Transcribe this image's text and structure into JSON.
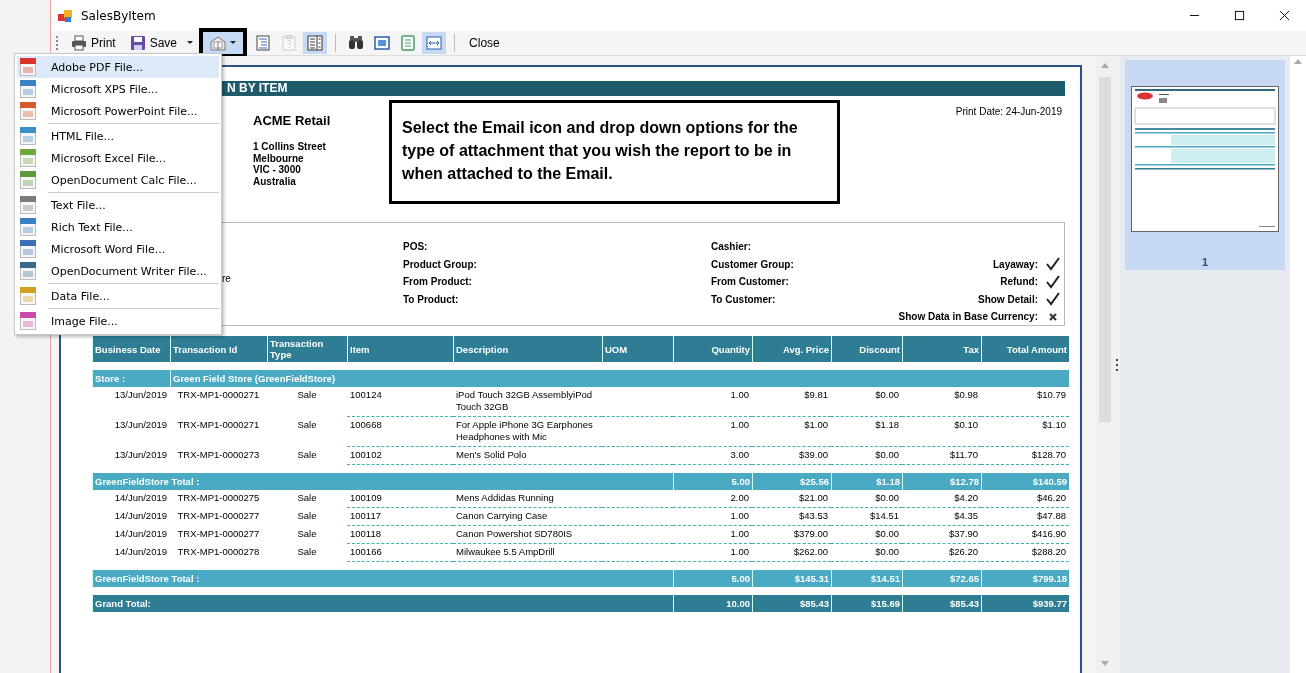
{
  "window": {
    "title": "SalesByItem"
  },
  "toolbar": {
    "items": [
      {
        "kind": "print",
        "label": "Print",
        "pressed": false,
        "disabled": false,
        "outlined": false
      },
      {
        "kind": "save",
        "label": "Save",
        "pressed": false,
        "disabled": false,
        "outlined": false
      },
      {
        "kind": "email",
        "pressed": true,
        "disabled": false,
        "outlined": true
      },
      {
        "kind": "document-map",
        "pressed": false,
        "disabled": false,
        "outlined": false
      },
      {
        "kind": "parameters",
        "pressed": false,
        "disabled": true,
        "outlined": false
      },
      {
        "kind": "thumbnails",
        "pressed": true,
        "disabled": false,
        "outlined": false
      },
      {
        "kind": "separator"
      },
      {
        "kind": "find",
        "pressed": false,
        "disabled": false,
        "outlined": false
      },
      {
        "kind": "single-page",
        "pressed": false,
        "disabled": false,
        "outlined": false
      },
      {
        "kind": "whole-page",
        "pressed": false,
        "disabled": false,
        "outlined": false
      },
      {
        "kind": "page-width",
        "pressed": true,
        "disabled": false,
        "outlined": false
      },
      {
        "kind": "separator"
      },
      {
        "kind": "close",
        "label": "Close",
        "pressed": false,
        "disabled": false,
        "outlined": false
      }
    ]
  },
  "export_menu": {
    "groups": [
      [
        {
          "label": "Adobe PDF File...",
          "color": "#d9342b",
          "selected": true
        },
        {
          "label": "Microsoft XPS File...",
          "color": "#3b7fc4",
          "selected": false
        },
        {
          "label": "Microsoft PowerPoint File...",
          "color": "#d65a2a",
          "selected": false
        }
      ],
      [
        {
          "label": "HTML File...",
          "color": "#3b8fc4",
          "selected": false
        },
        {
          "label": "Microsoft Excel File...",
          "color": "#6fa83a",
          "selected": false
        },
        {
          "label": "OpenDocument Calc File...",
          "color": "#5a9a3a",
          "selected": false
        }
      ],
      [
        {
          "label": "Text File...",
          "color": "#7a7a7a",
          "selected": false
        },
        {
          "label": "Rich Text File...",
          "color": "#3b7fc4",
          "selected": false
        },
        {
          "label": "Microsoft Word File...",
          "color": "#3b6fb4",
          "selected": false
        },
        {
          "label": "OpenDocument Writer File...",
          "color": "#3a6a8a",
          "selected": false
        }
      ],
      [
        {
          "label": "Data File...",
          "color": "#d4a020",
          "selected": false
        }
      ],
      [
        {
          "label": "Image File...",
          "color": "#c84aa8",
          "selected": false
        }
      ]
    ]
  },
  "report": {
    "title": "N BY ITEM",
    "company": {
      "name": "ACME Retail",
      "address": [
        "1 Collins Street",
        "Melbourne",
        "VIC - 3000",
        "Australia"
      ]
    },
    "print_date": "Print Date: 24-Jun-2019",
    "callout": "Select the Email icon and drop down options for the type of attachment that you wish the report to be in when attached to the Email.",
    "filters": {
      "left_fragment": "re",
      "middle": [
        "POS:",
        "Product Group:",
        "From Product:",
        "To Product:"
      ],
      "right": [
        "Cashier:",
        "Customer Group:",
        "From Customer:",
        "To Customer:"
      ],
      "options": [
        {
          "label": "Layaway:",
          "checked": true
        },
        {
          "label": "Refund:",
          "checked": true
        },
        {
          "label": "Show Detail:",
          "checked": true
        },
        {
          "label": "Show Data in Base Currency:",
          "checked": false
        }
      ]
    },
    "table": {
      "columns": [
        "Business Date",
        "Transaction Id",
        "Transaction Type",
        "Item",
        "Description",
        "UOM",
        "Quantity",
        "Avg. Price",
        "Discount",
        "Tax",
        "Total Amount"
      ],
      "rows": [
        {
          "kind": "store",
          "label": "Store :",
          "value": "Green Field Store (GreenFieldStore)"
        },
        {
          "kind": "data",
          "cells": [
            "13/Jun/2019",
            "TRX-MP1-0000271",
            "Sale",
            "100124",
            "iPod Touch 32GB AssemblyiPod Touch 32GB",
            "",
            "1.00",
            "$9.81",
            "$0.00",
            "$0.98",
            "$10.79"
          ]
        },
        {
          "kind": "data",
          "cells": [
            "13/Jun/2019",
            "TRX-MP1-0000271",
            "Sale",
            "100668",
            "For Apple iPhone 3G Earphones Headphones with Mic",
            "",
            "1.00",
            "$1.00",
            "$1.18",
            "$0.10",
            "$1.10"
          ]
        },
        {
          "kind": "data",
          "cells": [
            "13/Jun/2019",
            "TRX-MP1-0000273",
            "Sale",
            "100102",
            "Men's Solid Polo",
            "",
            "3.00",
            "$39.00",
            "$0.00",
            "$11.70",
            "$128.70"
          ]
        },
        {
          "kind": "total",
          "label": "GreenFieldStore Total :",
          "values": [
            "5.00",
            "$25.56",
            "$1.18",
            "$12.78",
            "$140.59"
          ]
        },
        {
          "kind": "data",
          "cells": [
            "14/Jun/2019",
            "TRX-MP1-0000275",
            "Sale",
            "100109",
            "Mens Addidas Running",
            "",
            "2.00",
            "$21.00",
            "$0.00",
            "$4.20",
            "$46.20"
          ]
        },
        {
          "kind": "data",
          "cells": [
            "14/Jun/2019",
            "TRX-MP1-0000277",
            "Sale",
            "100117",
            "Canon Carrying Case",
            "",
            "1.00",
            "$43.53",
            "$14.51",
            "$4.35",
            "$47.88"
          ]
        },
        {
          "kind": "data",
          "cells": [
            "14/Jun/2019",
            "TRX-MP1-0000277",
            "Sale",
            "100118",
            "Canon Powershot SD780IS",
            "",
            "1.00",
            "$379.00",
            "$0.00",
            "$37.90",
            "$416.90"
          ]
        },
        {
          "kind": "data",
          "cells": [
            "14/Jun/2019",
            "TRX-MP1-0000278",
            "Sale",
            "100166",
            "Milwaukee 5.5 AmpDrill",
            "",
            "1.00",
            "$262.00",
            "$0.00",
            "$26.20",
            "$288.20"
          ]
        },
        {
          "kind": "total",
          "label": "GreenFieldStore Total :",
          "values": [
            "5.00",
            "$145.31",
            "$14.51",
            "$72.65",
            "$799.18"
          ]
        },
        {
          "kind": "grand",
          "label": "Grand Total:",
          "values": [
            "10.00",
            "$85.43",
            "$15.69",
            "$85.43",
            "$939.77"
          ]
        }
      ]
    }
  },
  "thumbnails": [
    {
      "page": "1",
      "selected": true
    }
  ]
}
